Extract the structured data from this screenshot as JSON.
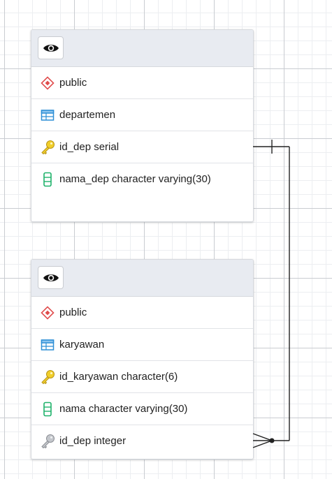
{
  "tables": [
    {
      "schema": "public",
      "name": "departemen",
      "columns": [
        {
          "label": "id_dep serial",
          "kind": "primary-key"
        },
        {
          "label": "nama_dep character varying(30)",
          "kind": "column"
        }
      ]
    },
    {
      "schema": "public",
      "name": "karyawan",
      "columns": [
        {
          "label": "id_karyawan character(6)",
          "kind": "primary-key"
        },
        {
          "label": "nama character varying(30)",
          "kind": "column"
        },
        {
          "label": "id_dep integer",
          "kind": "foreign-key"
        }
      ]
    }
  ],
  "relationship": {
    "from": "karyawan.id_dep",
    "to": "departemen.id_dep",
    "type": "many-to-one"
  },
  "colors": {
    "grid_major": "#c9ccd1",
    "grid_minor": "#eceef1",
    "header_bg": "#e8ebf1",
    "schema_icon": "#e04b4b",
    "table_icon": "#2e8fd6",
    "key_icon": "#e8c21b",
    "column_icon": "#1fb26b",
    "fk_icon": "#a8abb0",
    "line": "#222222"
  }
}
